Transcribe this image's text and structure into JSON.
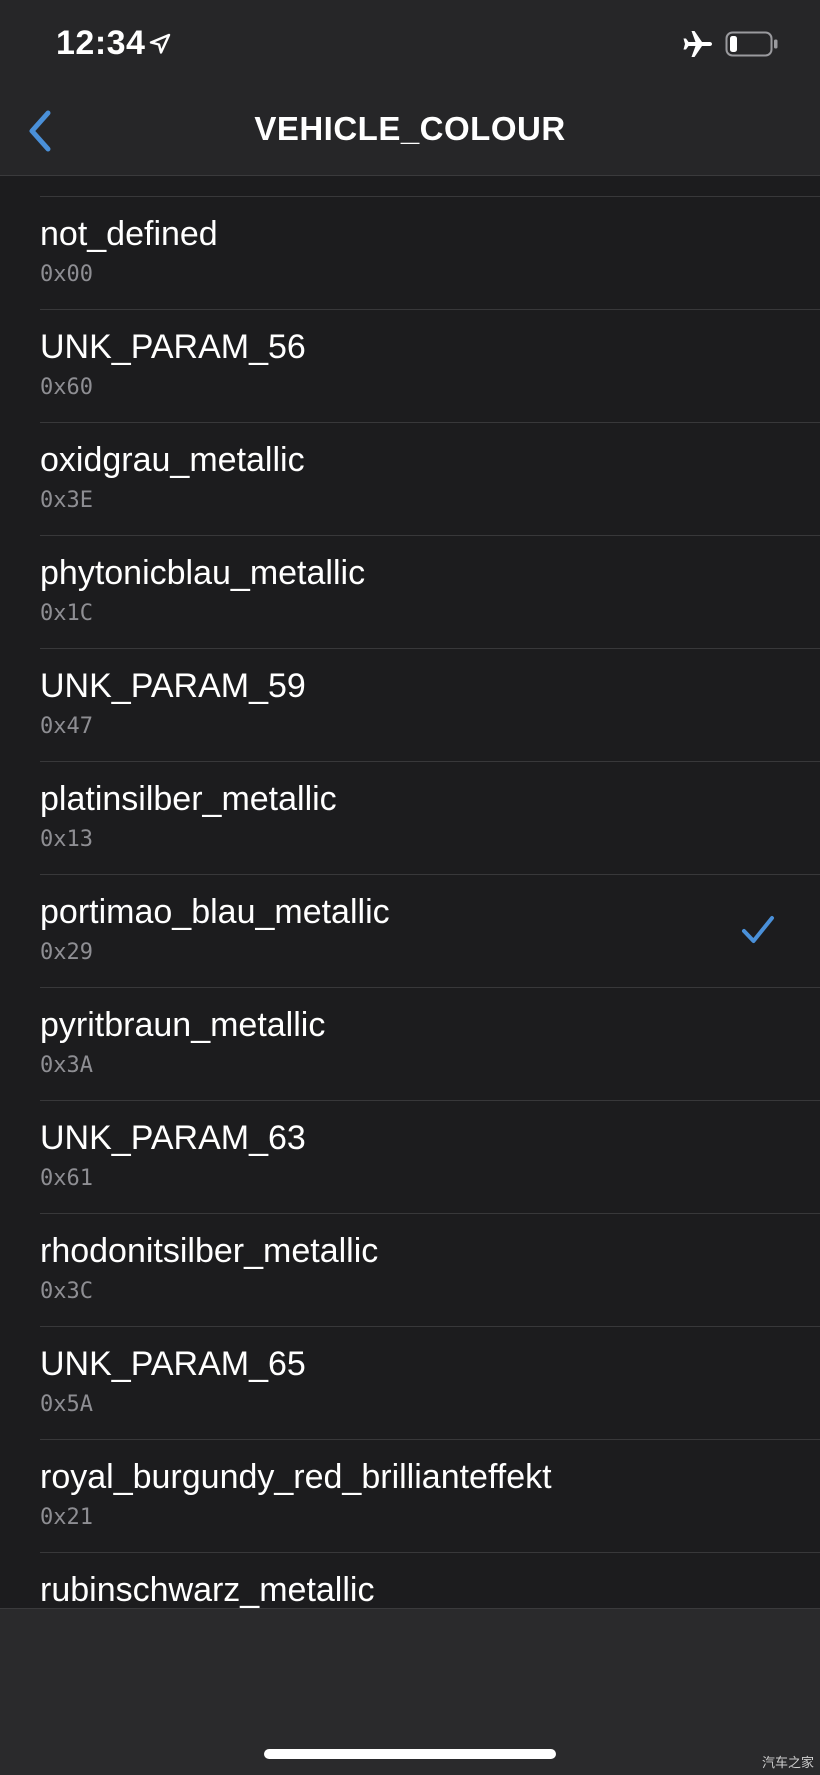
{
  "status_bar": {
    "time": "12:34",
    "icons": [
      "location-arrow-icon",
      "airplane-icon",
      "battery-low-icon"
    ]
  },
  "nav": {
    "title": "VEHICLE_COLOUR",
    "back_icon": "chevron-left-icon"
  },
  "colors": {
    "accent": "#4a90d9",
    "background": "#1c1c1e",
    "secondary_text": "#8e8e93"
  },
  "list": {
    "items": [
      {
        "name": "not_defined",
        "code": "0x00",
        "selected": false
      },
      {
        "name": "UNK_PARAM_56",
        "code": "0x60",
        "selected": false
      },
      {
        "name": "oxidgrau_metallic",
        "code": "0x3E",
        "selected": false
      },
      {
        "name": "phytonicblau_metallic",
        "code": "0x1C",
        "selected": false
      },
      {
        "name": "UNK_PARAM_59",
        "code": "0x47",
        "selected": false
      },
      {
        "name": "platinsilber_metallic",
        "code": "0x13",
        "selected": false
      },
      {
        "name": "portimao_blau_metallic",
        "code": "0x29",
        "selected": true
      },
      {
        "name": "pyritbraun_metallic",
        "code": "0x3A",
        "selected": false
      },
      {
        "name": "UNK_PARAM_63",
        "code": "0x61",
        "selected": false
      },
      {
        "name": "rhodonitsilber_metallic",
        "code": "0x3C",
        "selected": false
      },
      {
        "name": "UNK_PARAM_65",
        "code": "0x5A",
        "selected": false
      },
      {
        "name": "royal_burgundy_red_brillianteffekt",
        "code": "0x21",
        "selected": false
      },
      {
        "name": "rubinschwarz_metallic",
        "code": "",
        "selected": false
      }
    ]
  },
  "watermark": "汽车之家"
}
